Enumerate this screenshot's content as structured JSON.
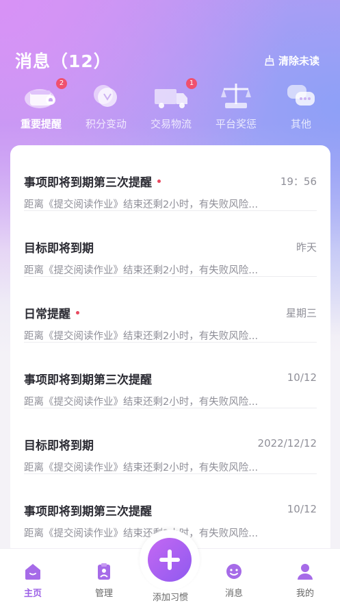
{
  "header": {
    "title": "消息（12）",
    "clear_label": "清除未读"
  },
  "categories": [
    {
      "label": "重要提醒",
      "badge": "2",
      "icon": "calendar-bell-icon",
      "active": true
    },
    {
      "label": "积分变动",
      "badge": "",
      "icon": "coin-icon",
      "active": false
    },
    {
      "label": "交易物流",
      "badge": "1",
      "icon": "delivery-truck-icon",
      "active": false
    },
    {
      "label": "平台奖惩",
      "badge": "",
      "icon": "scale-icon",
      "active": false
    },
    {
      "label": "其他",
      "badge": "",
      "icon": "chat-bubbles-icon",
      "active": false
    }
  ],
  "messages": [
    {
      "title": "事项即将到期第三次提醒",
      "unread": true,
      "time": "19：56",
      "desc": "距离《提交阅读作业》结束还剩2小时，有失败风险..."
    },
    {
      "title": "目标即将到期",
      "unread": false,
      "time": "昨天",
      "desc": "距离《提交阅读作业》结束还剩2小时，有失败风险..."
    },
    {
      "title": "日常提醒",
      "unread": true,
      "time": "星期三",
      "desc": "距离《提交阅读作业》结束还剩2小时，有失败风险..."
    },
    {
      "title": "事项即将到期第三次提醒",
      "unread": false,
      "time": "10/12",
      "desc": "距离《提交阅读作业》结束还剩2小时，有失败风险..."
    },
    {
      "title": "目标即将到期",
      "unread": false,
      "time": "2022/12/12",
      "desc": "距离《提交阅读作业》结束还剩2小时，有失败风险..."
    },
    {
      "title": "事项即将到期第三次提醒",
      "unread": false,
      "time": "10/12",
      "desc": "距离《提交阅读作业》结束还剩2小时，有失败风险..."
    }
  ],
  "tabbar": {
    "home": "主页",
    "manage": "管理",
    "add": "添加习惯",
    "messages": "消息",
    "mine": "我的"
  },
  "colors": {
    "accent": "#9b5fe6",
    "badge": "#f0506e",
    "unread_dot": "#e8495f"
  }
}
